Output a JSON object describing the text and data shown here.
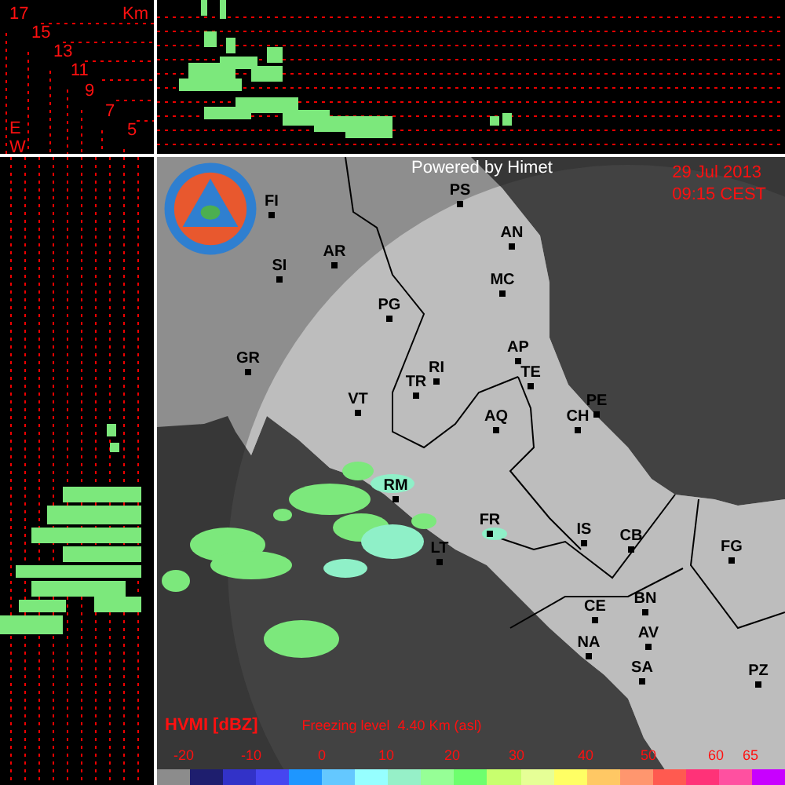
{
  "scale_panel": {
    "labels": [
      "17",
      "15",
      "13",
      "11",
      "9",
      "7",
      "5"
    ],
    "unit": "Km",
    "axis_letters": [
      "E",
      "W"
    ]
  },
  "map": {
    "credit": "Powered by Himet",
    "date": "29 Jul 2013",
    "time": "09:15 CEST",
    "cities": [
      {
        "label": "FI"
      },
      {
        "label": "SI"
      },
      {
        "label": "AR"
      },
      {
        "label": "GR"
      },
      {
        "label": "PG"
      },
      {
        "label": "PS"
      },
      {
        "label": "AN"
      },
      {
        "label": "MC"
      },
      {
        "label": "AP"
      },
      {
        "label": "TE"
      },
      {
        "label": "PE"
      },
      {
        "label": "CH"
      },
      {
        "label": "AQ"
      },
      {
        "label": "RI"
      },
      {
        "label": "TR"
      },
      {
        "label": "VT"
      },
      {
        "label": "RM"
      },
      {
        "label": "LT"
      },
      {
        "label": "FR"
      },
      {
        "label": "IS"
      },
      {
        "label": "CB"
      },
      {
        "label": "FG"
      },
      {
        "label": "CE"
      },
      {
        "label": "BN"
      },
      {
        "label": "AV"
      },
      {
        "label": "NA"
      },
      {
        "label": "SA"
      },
      {
        "label": "PZ"
      }
    ],
    "product": "HVMI [dBZ]",
    "freezing_level": "Freezing level  4.40 Km (asl)"
  },
  "legend": {
    "ticks": [
      "-20",
      "-10",
      "0",
      "10",
      "20",
      "30",
      "40",
      "50",
      "60",
      "65"
    ],
    "colors": [
      {
        "color": "#8c8c8c"
      },
      {
        "color": "#1e1e6e"
      },
      {
        "color": "#3232c8"
      },
      {
        "color": "#4646f0"
      },
      {
        "color": "#1e96ff"
      },
      {
        "color": "#64c8ff"
      },
      {
        "color": "#96ffff"
      },
      {
        "color": "#96f0c8"
      },
      {
        "color": "#96ff96"
      },
      {
        "color": "#6eff6e"
      },
      {
        "color": "#c8ff6e"
      },
      {
        "color": "#e6ff96"
      },
      {
        "color": "#ffff64"
      },
      {
        "color": "#ffc864"
      },
      {
        "color": "#ff966e"
      },
      {
        "color": "#ff5a50"
      },
      {
        "color": "#ff3278"
      },
      {
        "color": "#ff50a0"
      },
      {
        "color": "#c800ff"
      }
    ]
  }
}
